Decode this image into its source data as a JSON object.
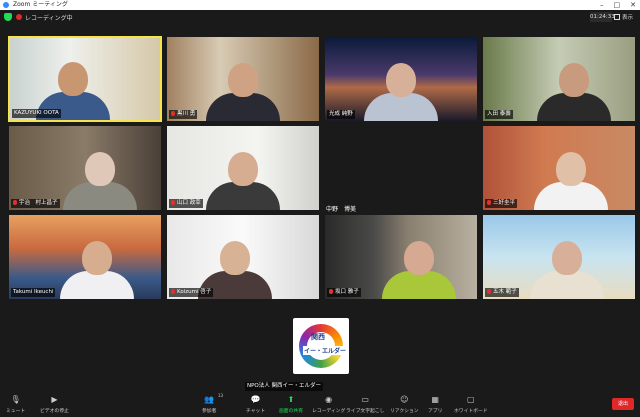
{
  "window": {
    "title": "Zoom ミーティング"
  },
  "topbar": {
    "recording_label": "レコーディング中",
    "timer": "01:24:33",
    "view_label": "表示"
  },
  "participants": [
    {
      "name": "KAZUYUKI OOTA",
      "muted": false
    },
    {
      "name": "黒川 勇",
      "muted": true
    },
    {
      "name": "光成 純野",
      "muted": false
    },
    {
      "name": "入田 泰壽",
      "muted": false
    },
    {
      "name": "宇治　村上昌子",
      "muted": true
    },
    {
      "name": "山口 政幸",
      "muted": true
    },
    {
      "name": "中野　博美",
      "muted": false
    },
    {
      "name": "三好圭平",
      "muted": true
    },
    {
      "name": "Takumi Ikeuchi",
      "muted": false
    },
    {
      "name": "Koizumi 啓子",
      "muted": true
    },
    {
      "name": "坂口 雅子",
      "muted": true
    },
    {
      "name": "五木 範子",
      "muted": true
    }
  ],
  "logo": {
    "line1": "関西",
    "line2": "イー・エルダー",
    "caption": "NPO法人 関西イー・エルダー"
  },
  "toolbar": {
    "items": [
      {
        "label": "ミュート",
        "icon": "mic-icon"
      },
      {
        "label": "ビデオの停止",
        "icon": "video-icon"
      },
      {
        "label": "参加者",
        "icon": "participants-icon",
        "count": "13"
      },
      {
        "label": "チャット",
        "icon": "chat-icon"
      },
      {
        "label": "画面の共有",
        "icon": "share-screen-icon"
      },
      {
        "label": "レコーディング",
        "icon": "record-icon"
      },
      {
        "label": "ライブ文字起こし",
        "icon": "cc-icon"
      },
      {
        "label": "リアクション",
        "icon": "reaction-icon"
      },
      {
        "label": "アプリ",
        "icon": "apps-icon"
      },
      {
        "label": "ホワイトボード",
        "icon": "whiteboard-icon"
      }
    ],
    "end_label": "退出"
  },
  "colors": {
    "accent": "#2d8cff",
    "active_speaker": "#f4e34a",
    "share_green": "#23d959",
    "end_red": "#e02828"
  }
}
